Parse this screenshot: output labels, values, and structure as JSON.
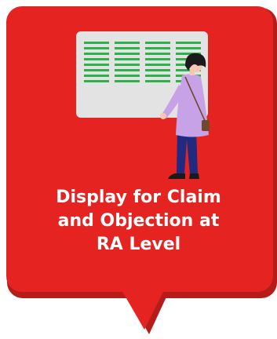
{
  "card": {
    "title": "Display for Claim\nand Objection at\nRA Level",
    "icon": "person-viewing-notice-board-icon"
  },
  "colors": {
    "card_red": "#E52421",
    "card_shadow": "#B51C1A",
    "board": "#E3E3E3",
    "board_lines": "#2DB24A",
    "coat": "#C8A2E6",
    "pants": "#1F2A80",
    "hair": "#1A1A1A",
    "skin": "#F7C7B3",
    "bag": "#6B4A2E"
  }
}
